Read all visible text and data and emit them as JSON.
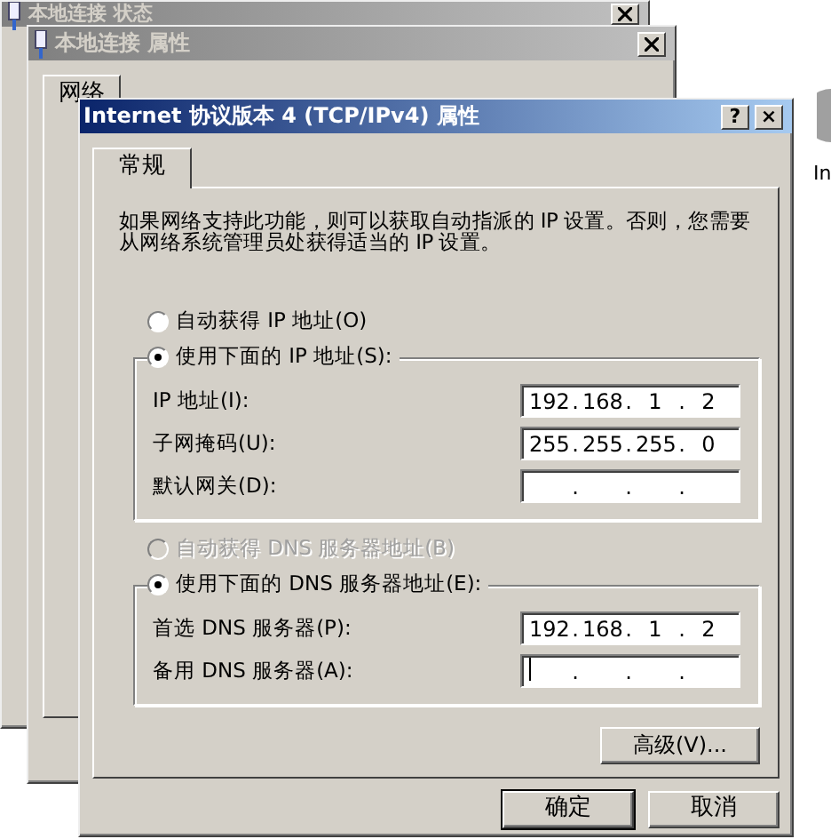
{
  "back_windows": [
    {
      "title": "本地连接 状态"
    },
    {
      "title": "本地连接 属性",
      "tabs": [
        {
          "label": "网络",
          "selected": true
        }
      ]
    }
  ],
  "desktop": {
    "icon_label": "In"
  },
  "dialog": {
    "title": "Internet 协议版本 4 (TCP/IPv4) 属性",
    "title_buttons": [
      "?",
      "×"
    ],
    "tabs": [
      {
        "label": "常规",
        "selected": true
      }
    ],
    "description": "如果网络支持此功能，则可以获取自动指派的 IP 设置。否则，您需要从网络系统管理员处获得适当的 IP 设置。",
    "separator": ".",
    "ip_options": [
      {
        "label": "自动获得 IP 地址(O)",
        "selected": false,
        "disabled": false
      },
      {
        "label": "使用下面的 IP 地址(S):",
        "selected": true,
        "disabled": false
      }
    ],
    "ip_fields": [
      {
        "label": "IP 地址(I):",
        "octets": [
          "192",
          "168",
          "1",
          "2"
        ]
      },
      {
        "label": "子网掩码(U):",
        "octets": [
          "255",
          "255",
          "255",
          "0"
        ]
      },
      {
        "label": "默认网关(D):"
      }
    ],
    "dns_options": [
      {
        "label": "自动获得 DNS 服务器地址(B)",
        "selected": false,
        "disabled": true
      },
      {
        "label": "使用下面的 DNS 服务器地址(E):",
        "selected": true,
        "disabled": false
      }
    ],
    "dns_fields": [
      {
        "label": "首选 DNS 服务器(P):",
        "octets": [
          "192",
          "168",
          "1",
          "2"
        ]
      },
      {
        "label": "备用 DNS 服务器(A):",
        "focused": true
      }
    ],
    "advanced_button": "高级(V)...",
    "buttons": [
      {
        "label": "确定",
        "default": true
      },
      {
        "label": "取消",
        "default": false
      }
    ]
  }
}
